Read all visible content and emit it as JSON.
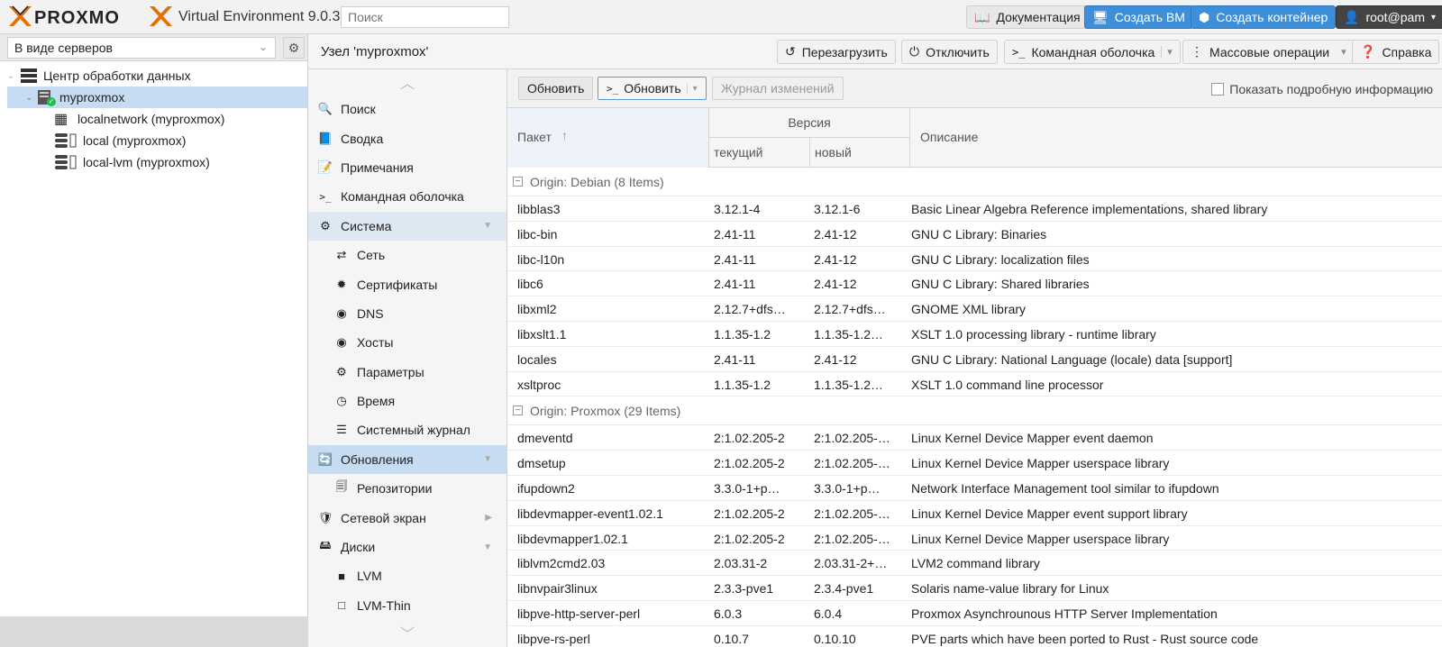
{
  "header": {
    "logo_text": "PROXMOX",
    "version": "Virtual Environment 9.0.3",
    "search_placeholder": "Поиск",
    "doc_button": "Документация",
    "create_vm": "Создать ВМ",
    "create_ct": "Создать контейнер",
    "user": "root@pam"
  },
  "tree": {
    "view": "В виде серверов",
    "items": [
      {
        "label": "Центр обработки данных"
      },
      {
        "label": "myproxmox"
      },
      {
        "label": "localnetwork (myproxmox)"
      },
      {
        "label": "local (myproxmox)"
      },
      {
        "label": "local-lvm (myproxmox)"
      }
    ]
  },
  "node": {
    "title": "Узел 'myproxmox'",
    "reboot": "Перезагрузить",
    "shutdown": "Отключить",
    "shell": "Командная оболочка",
    "bulk": "Массовые операции",
    "help": "Справка"
  },
  "nav": {
    "items": [
      {
        "label": "Поиск",
        "icon": "search-icon"
      },
      {
        "label": "Сводка",
        "icon": "book-icon"
      },
      {
        "label": "Примечания",
        "icon": "notes-icon"
      },
      {
        "label": "Командная оболочка",
        "icon": "terminal-icon"
      },
      {
        "label": "Система",
        "icon": "cogs-icon"
      },
      {
        "label": "Сеть",
        "icon": "exchange-icon"
      },
      {
        "label": "Сертификаты",
        "icon": "certificate-icon"
      },
      {
        "label": "DNS",
        "icon": "globe-icon"
      },
      {
        "label": "Хосты",
        "icon": "globe-icon"
      },
      {
        "label": "Параметры",
        "icon": "gear-icon"
      },
      {
        "label": "Время",
        "icon": "clock-icon"
      },
      {
        "label": "Системный журнал",
        "icon": "list-icon"
      },
      {
        "label": "Обновления",
        "icon": "refresh-icon"
      },
      {
        "label": "Репозитории",
        "icon": "files-icon"
      },
      {
        "label": "Сетевой экран",
        "icon": "shield-icon"
      },
      {
        "label": "Диски",
        "icon": "hdd-icon"
      },
      {
        "label": "LVM",
        "icon": "square-icon"
      },
      {
        "label": "LVM-Thin",
        "icon": "square-outline-icon"
      }
    ]
  },
  "updates": {
    "refresh": "Обновить",
    "upgrade": "Обновить",
    "changelog": "Журнал изменений",
    "show_details": "Показать подробную информацию",
    "columns": {
      "package": "Пакет",
      "version": "Версия",
      "current": "текущий",
      "new": "новый",
      "description": "Описание"
    },
    "groups": [
      {
        "title": "Origin: Debian (8 Items)",
        "rows": [
          [
            "libblas3",
            "3.12.1-4",
            "3.12.1-6",
            "Basic Linear Algebra Reference implementations, shared library"
          ],
          [
            "libc-bin",
            "2.41-11",
            "2.41-12",
            "GNU C Library: Binaries"
          ],
          [
            "libc-l10n",
            "2.41-11",
            "2.41-12",
            "GNU C Library: localization files"
          ],
          [
            "libc6",
            "2.41-11",
            "2.41-12",
            "GNU C Library: Shared libraries"
          ],
          [
            "libxml2",
            "2.12.7+dfs…",
            "2.12.7+dfs…",
            "GNOME XML library"
          ],
          [
            "libxslt1.1",
            "1.1.35-1.2",
            "1.1.35-1.2…",
            "XSLT 1.0 processing library - runtime library"
          ],
          [
            "locales",
            "2.41-11",
            "2.41-12",
            "GNU C Library: National Language (locale) data [support]"
          ],
          [
            "xsltproc",
            "1.1.35-1.2",
            "1.1.35-1.2…",
            "XSLT 1.0 command line processor"
          ]
        ]
      },
      {
        "title": "Origin: Proxmox (29 Items)",
        "rows": [
          [
            "dmeventd",
            "2:1.02.205-2",
            "2:1.02.205-…",
            "Linux Kernel Device Mapper event daemon"
          ],
          [
            "dmsetup",
            "2:1.02.205-2",
            "2:1.02.205-…",
            "Linux Kernel Device Mapper userspace library"
          ],
          [
            "ifupdown2",
            "3.3.0-1+p…",
            "3.3.0-1+p…",
            "Network Interface Management tool similar to ifupdown"
          ],
          [
            "libdevmapper-event1.02.1",
            "2:1.02.205-2",
            "2:1.02.205-…",
            "Linux Kernel Device Mapper event support library"
          ],
          [
            "libdevmapper1.02.1",
            "2:1.02.205-2",
            "2:1.02.205-…",
            "Linux Kernel Device Mapper userspace library"
          ],
          [
            "liblvm2cmd2.03",
            "2.03.31-2",
            "2.03.31-2+…",
            "LVM2 command library"
          ],
          [
            "libnvpair3linux",
            "2.3.3-pve1",
            "2.3.4-pve1",
            "Solaris name-value library for Linux"
          ],
          [
            "libpve-http-server-perl",
            "6.0.3",
            "6.0.4",
            "Proxmox Asynchrounous HTTP Server Implementation"
          ],
          [
            "libpve-rs-perl",
            "0.10.7",
            "0.10.10",
            "PVE parts which have been ported to Rust - Rust source code"
          ]
        ]
      }
    ]
  }
}
